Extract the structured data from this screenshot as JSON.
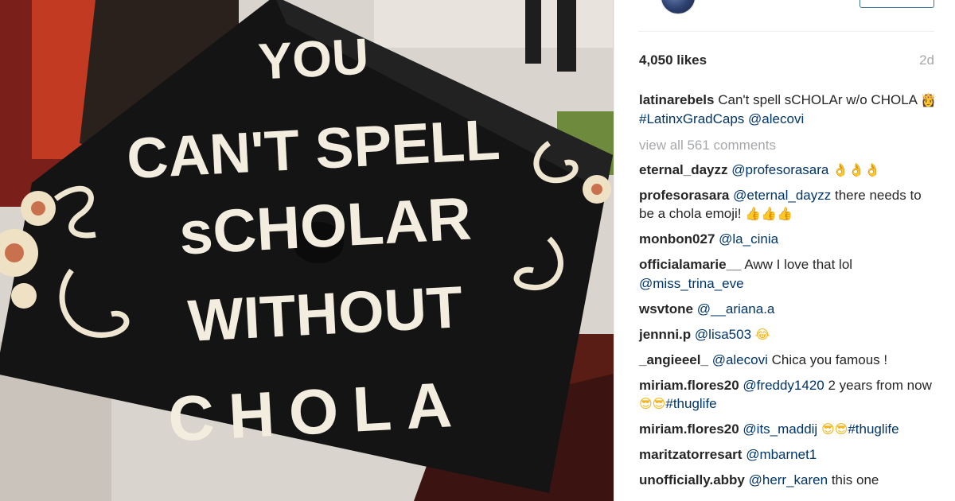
{
  "post": {
    "likes": "4,050 likes",
    "time_ago": "2d",
    "caption": {
      "user": "latinarebels",
      "text": "Can't spell sCHOLAr w/o CHOLA",
      "emoji": "👸",
      "hashtag": "#LatinxGradCaps",
      "mention": "@alecovi"
    },
    "view_all_comments": "view all 561 comments"
  },
  "comments": [
    {
      "user": "eternal_dayzz",
      "mention": "@profesorasara",
      "text": "",
      "emoji": "👌👌👌"
    },
    {
      "user": "profesorasara",
      "mention": "@eternal_dayzz",
      "text": "there needs to be a chola emoji!",
      "emoji": "👍👍👍"
    },
    {
      "user": "monbon027",
      "mention": "@la_cinia",
      "text": "",
      "emoji": ""
    },
    {
      "user": "officialamarie__",
      "mention": "",
      "text": "Aww I love that lol",
      "mention2": "@miss_trina_eve"
    },
    {
      "user": "wsvtone",
      "mention": "@__ariana.a",
      "text": ""
    },
    {
      "user": "jennni.p",
      "mention": "@lisa503",
      "text": "",
      "emoji": "😂"
    },
    {
      "user": "_angieeel_",
      "mention": "@alecovi",
      "text": "Chica you famous !"
    },
    {
      "user": "miriam.flores20",
      "mention": "@freddy1420",
      "text": "2 years from now",
      "emoji": "😎😎",
      "hashtag": "#thuglife"
    },
    {
      "user": "miriam.flores20",
      "mention": "@its_maddij",
      "text": "",
      "emoji": "😎😎",
      "hashtag": "#thuglife"
    },
    {
      "user": "maritzatorresart",
      "mention": "@mbarnet1",
      "text": ""
    },
    {
      "user": "unofficially.abby",
      "mention": "@herr_karen",
      "text": "this one"
    }
  ],
  "photo": {
    "cap_text": [
      "YOU",
      "CAN'T SPELL",
      "sCHOLAR",
      "WITHOUT",
      "CHOLA"
    ]
  },
  "colors": {
    "link": "#003569",
    "muted": "#a5a7aa",
    "cap": "#151515",
    "cap_lettering": "#f3ede0"
  }
}
